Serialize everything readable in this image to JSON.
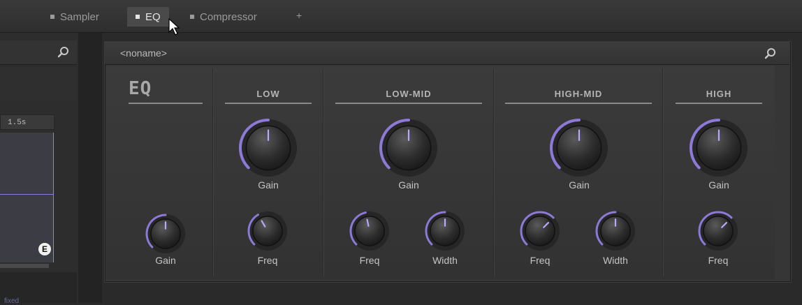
{
  "tabs": [
    {
      "label": "Sampler",
      "active": false
    },
    {
      "label": "EQ",
      "active": true
    },
    {
      "label": "Compressor",
      "active": false
    }
  ],
  "tab_add": "+",
  "left_panel": {
    "time_label": "1.5s",
    "badge": "E",
    "bottom_link": "fixed"
  },
  "plugin": {
    "preset_name": "<noname>",
    "title": "EQ",
    "sections": {
      "low": "LOW",
      "low_mid": "LOW-MID",
      "high_mid": "HIGH-MID",
      "high": "HIGH"
    },
    "knobs": {
      "master_gain": "Gain",
      "low_gain": "Gain",
      "low_freq": "Freq",
      "lowmid_gain": "Gain",
      "lowmid_freq": "Freq",
      "lowmid_width": "Width",
      "highmid_gain": "Gain",
      "highmid_freq": "Freq",
      "highmid_width": "Width",
      "high_gain": "Gain",
      "high_freq": "Freq"
    }
  },
  "colors": {
    "accent": "#8d7ad8",
    "panel": "#363636",
    "background": "#2a2a2a"
  }
}
